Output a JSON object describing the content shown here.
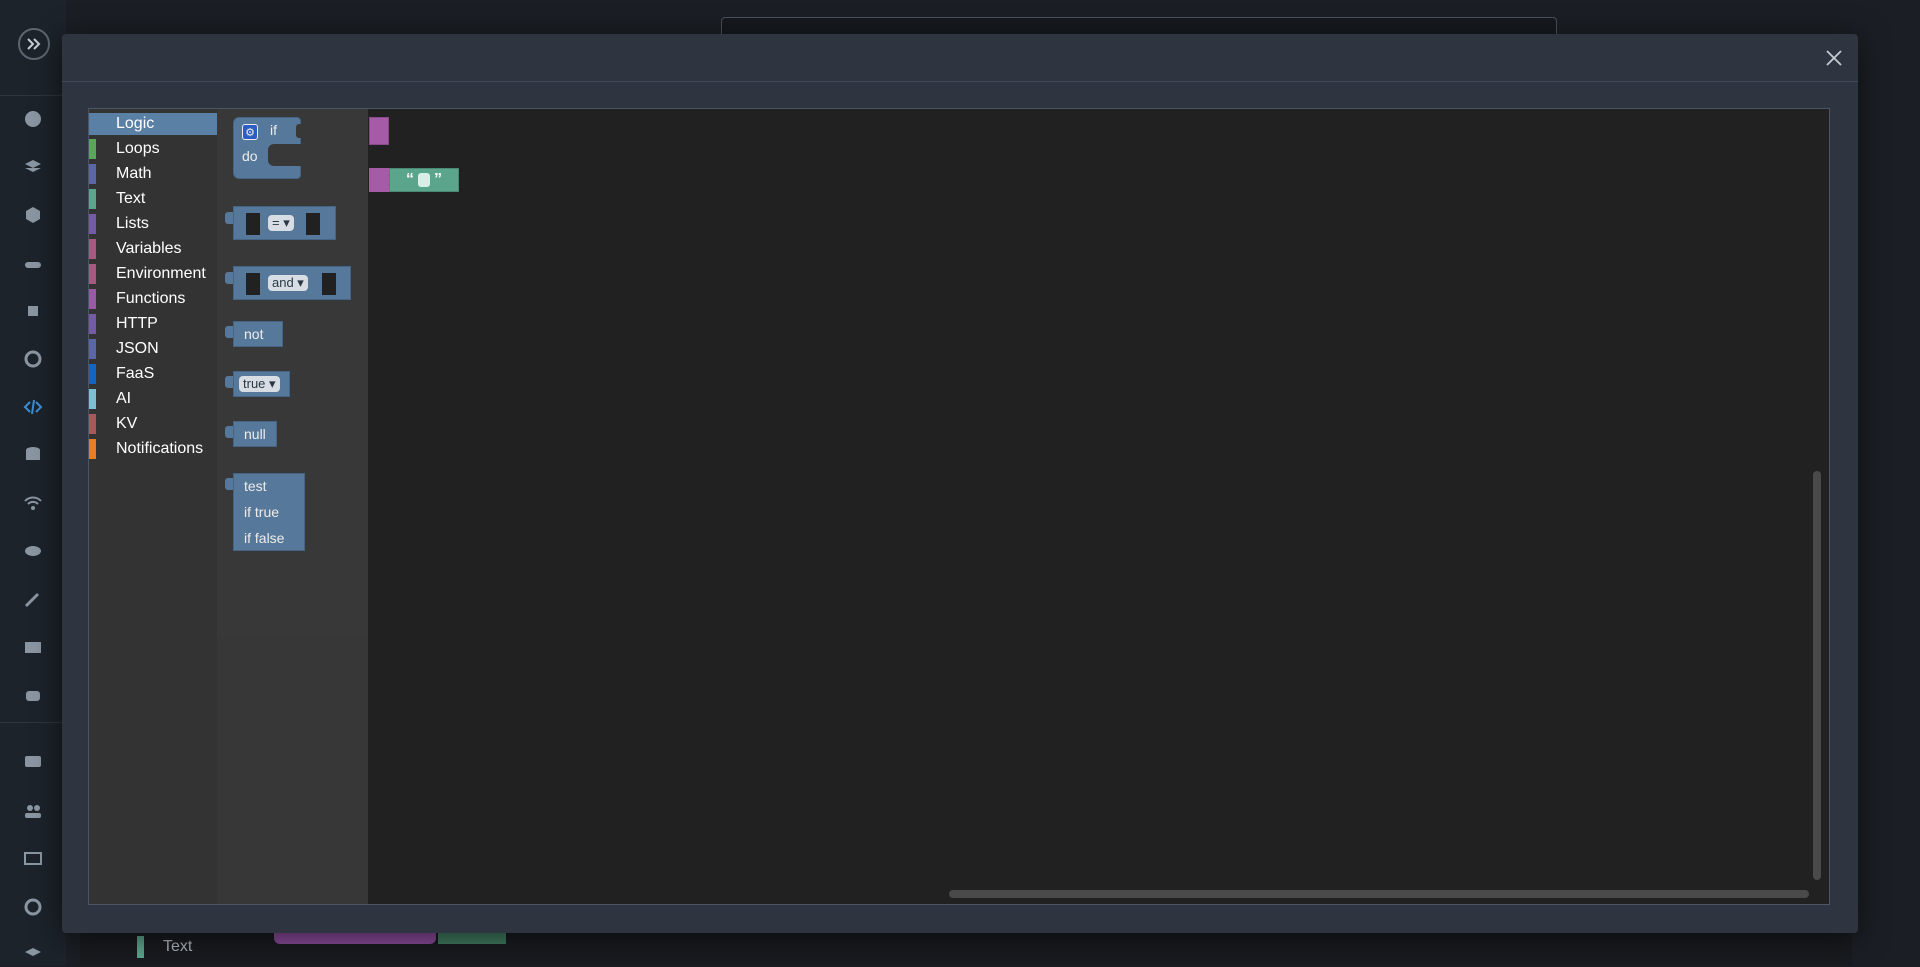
{
  "modal": {
    "close_icon": "close-icon"
  },
  "toolbox": {
    "categories": [
      {
        "label": "Logic",
        "color": "#5b80a5"
      },
      {
        "label": "Loops",
        "color": "#5ba55b"
      },
      {
        "label": "Math",
        "color": "#5b67a5"
      },
      {
        "label": "Text",
        "color": "#5ba58c"
      },
      {
        "label": "Lists",
        "color": "#745ba5"
      },
      {
        "label": "Variables",
        "color": "#a55b80"
      },
      {
        "label": "Environment",
        "color": "#a55b80"
      },
      {
        "label": "Functions",
        "color": "#995ba5"
      },
      {
        "label": "HTTP",
        "color": "#745ba5"
      },
      {
        "label": "JSON",
        "color": "#5b67a5"
      },
      {
        "label": "FaaS",
        "color": "#1565c0"
      },
      {
        "label": "AI",
        "color": "#7ec0d3"
      },
      {
        "label": "KV",
        "color": "#a55b5b"
      },
      {
        "label": "Notifications",
        "color": "#e67e22"
      }
    ]
  },
  "flyout": {
    "if_label": "if",
    "do_label": "do",
    "compare_op": "= ▾",
    "logic_op": "and ▾",
    "not_label": "not",
    "bool_value": "true ▾",
    "null_label": "null",
    "ternary_test": "test",
    "ternary_true": "if true",
    "ternary_false": "if false"
  },
  "workspace": {
    "text_block_quotes": "“ ”"
  },
  "background": {
    "toolbox_label": "Text"
  }
}
